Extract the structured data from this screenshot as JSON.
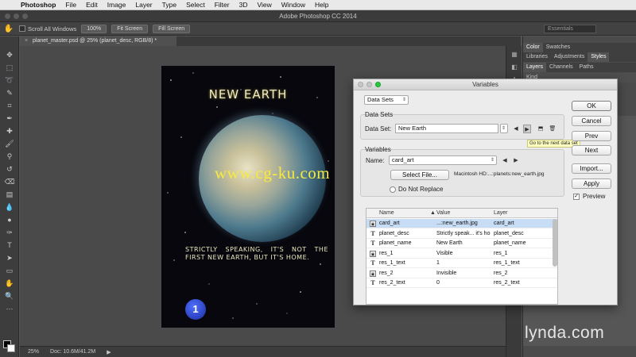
{
  "menubar": {
    "app": "Photoshop",
    "items": [
      "File",
      "Edit",
      "Image",
      "Layer",
      "Type",
      "Select",
      "Filter",
      "3D",
      "View",
      "Window",
      "Help"
    ]
  },
  "window": {
    "title": "Adobe Photoshop CC 2014"
  },
  "options_bar": {
    "scroll_all": "Scroll All Windows",
    "zoom_100": "100%",
    "fit_screen": "Fit Screen",
    "fill_screen": "Fill Screen",
    "workspace": "Essentials"
  },
  "document": {
    "tab": "planet_master.psd @ 25% (planet_desc, RGB/8) *",
    "title": "NEW EARTH",
    "description": "STRICTLY SPEAKING, IT'S NOT THE FIRST NEW EARTH, BUT IT'S HOME.",
    "badge": "1"
  },
  "status": {
    "zoom": "25%",
    "doc": "Doc: 10.6M/41.2M"
  },
  "panels": {
    "top_tabs": [
      "Color",
      "Swatches"
    ],
    "mid_tabs": [
      "Libraries",
      "Adjustments",
      "Styles"
    ],
    "layer_tabs": [
      "Layers",
      "Channels",
      "Paths"
    ],
    "kind": "Kind"
  },
  "dialog": {
    "title": "Variables",
    "mode_select": "Data Sets",
    "data_sets_group": "Data Sets",
    "data_set_label": "Data Set:",
    "data_set_value": "New Earth",
    "tooltip": "Go to the next data set",
    "variables_group": "Variables",
    "name_label": "Name:",
    "name_value": "card_art",
    "select_file": "Select File...",
    "file_path": "Macintosh HD:...:planets:new_earth.jpg",
    "do_not_replace": "Do Not Replace",
    "buttons": {
      "ok": "OK",
      "cancel": "Cancel",
      "prev": "Prev",
      "next": "Next",
      "import": "Import...",
      "apply": "Apply",
      "preview": "Preview"
    },
    "table": {
      "headers": [
        "Name",
        "Value",
        "Layer"
      ],
      "rows": [
        {
          "type": "pixel",
          "name": "card_art",
          "value": "...:new_earth.jpg",
          "layer": "card_art"
        },
        {
          "type": "text",
          "name": "planet_desc",
          "value": "Strictly speak... it's home.",
          "layer": "planet_desc"
        },
        {
          "type": "text",
          "name": "planet_name",
          "value": "New Earth",
          "layer": "planet_name"
        },
        {
          "type": "pixel",
          "name": "res_1",
          "value": "Visible",
          "layer": "res_1"
        },
        {
          "type": "text",
          "name": "res_1_text",
          "value": "1",
          "layer": "res_1_text"
        },
        {
          "type": "pixel",
          "name": "res_2",
          "value": "Invisible",
          "layer": "res_2"
        },
        {
          "type": "text",
          "name": "res_2_text",
          "value": "0",
          "layer": "res_2_text"
        }
      ]
    }
  },
  "watermarks": {
    "cg": "www.cg-ku.com",
    "lynda": "lynda.com"
  },
  "colors": {
    "accent": "#c7dcf5",
    "light_red": "#fe5f57",
    "light_yellow": "#febc2e",
    "light_green": "#28c840",
    "title_gold": "#eceac0",
    "watermark_yellow": "#f7ea3e"
  }
}
